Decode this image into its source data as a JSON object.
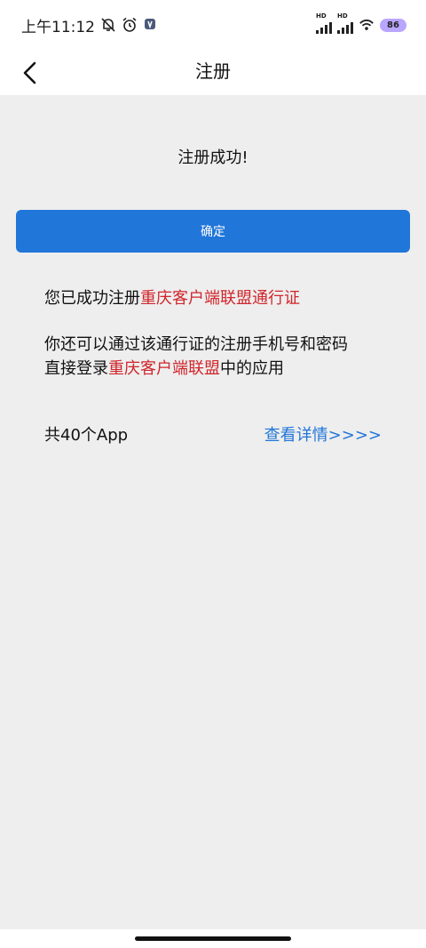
{
  "status_bar": {
    "time": "上午11:12",
    "battery": "86",
    "hd_label": "HD"
  },
  "header": {
    "title": "注册"
  },
  "main": {
    "success_message": "注册成功!",
    "confirm_label": "确定",
    "line1_prefix": "您已成功注册",
    "line1_highlight": "重庆客户端联盟通行证",
    "line2": "你还可以通过该通行证的注册手机号和密码",
    "line3_prefix": "直接登录",
    "line3_highlight": "重庆客户端联盟",
    "line3_suffix": "中的应用",
    "app_count": "共40个App",
    "details_link": "查看详情>>>>"
  },
  "colors": {
    "accent": "#2176d9",
    "highlight": "#d0262b",
    "background": "#eeeeee"
  },
  "icons": {
    "back": "chevron-left-icon",
    "mute": "bell-off-icon",
    "alarm": "alarm-clock-icon",
    "wifi": "wifi-icon"
  }
}
